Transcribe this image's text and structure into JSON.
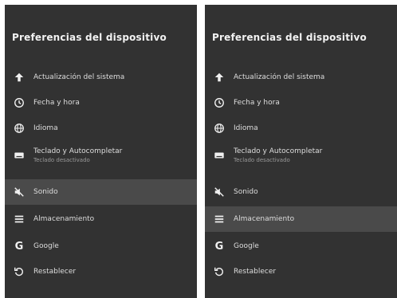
{
  "left_panel": {
    "title": "Preferencias del dispositivo",
    "items": [
      {
        "label": "Actualización del sistema",
        "sublabel": "",
        "icon": "arrow-up-icon"
      },
      {
        "label": "Fecha y hora",
        "sublabel": "",
        "icon": "clock-icon"
      },
      {
        "label": "Idioma",
        "sublabel": "",
        "icon": "globe-icon"
      },
      {
        "label": "Teclado y Autocompletar",
        "sublabel": "Teclado desactivado",
        "icon": "keyboard-icon"
      },
      {
        "label": "Sonido",
        "sublabel": "",
        "icon": "speaker-mute-icon",
        "selected": true
      },
      {
        "label": "Almacenamiento",
        "sublabel": "",
        "icon": "storage-list-icon"
      },
      {
        "label": "Google",
        "sublabel": "",
        "icon": "google-icon"
      },
      {
        "label": "Restablecer",
        "sublabel": "",
        "icon": "reset-icon"
      }
    ]
  },
  "right_panel": {
    "title": "Preferencias del dispositivo",
    "items": [
      {
        "label": "Actualización del sistema",
        "sublabel": "",
        "icon": "arrow-up-icon"
      },
      {
        "label": "Fecha y hora",
        "sublabel": "",
        "icon": "clock-icon"
      },
      {
        "label": "Idioma",
        "sublabel": "",
        "icon": "globe-icon"
      },
      {
        "label": "Teclado y Autocompletar",
        "sublabel": "Teclado desactivado",
        "icon": "keyboard-icon"
      },
      {
        "label": "Sonido",
        "sublabel": "",
        "icon": "speaker-mute-icon"
      },
      {
        "label": "Almacenamiento",
        "sublabel": "",
        "icon": "storage-list-icon",
        "selected": true
      },
      {
        "label": "Google",
        "sublabel": "",
        "icon": "google-icon"
      },
      {
        "label": "Restablecer",
        "sublabel": "",
        "icon": "reset-icon"
      }
    ]
  },
  "colors": {
    "panel_background": "#323232",
    "selected_row": "#4a4a4a",
    "text": "#dedede"
  }
}
